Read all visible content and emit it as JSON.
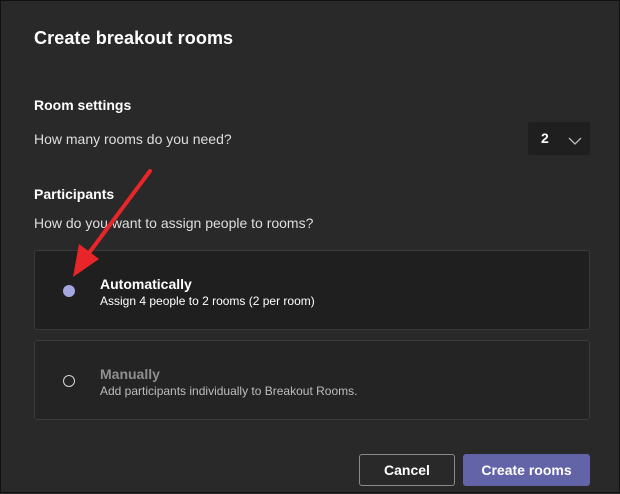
{
  "dialog": {
    "title": "Create breakout rooms"
  },
  "room_settings": {
    "heading": "Room settings",
    "question": "How many rooms do you need?",
    "rooms_count": "2"
  },
  "participants": {
    "heading": "Participants",
    "question": "How do you want to assign people to rooms?",
    "options": [
      {
        "title": "Automatically",
        "description": "Assign 4 people to 2 rooms (2 per room)",
        "selected": true
      },
      {
        "title": "Manually",
        "description": "Add participants individually to Breakout Rooms.",
        "selected": false
      }
    ]
  },
  "footer": {
    "cancel_label": "Cancel",
    "create_label": "Create rooms"
  },
  "colors": {
    "accent": "#6264a7",
    "radio_selected": "#a3a6df",
    "annotation_arrow": "#e8262a",
    "background": "#292929"
  }
}
